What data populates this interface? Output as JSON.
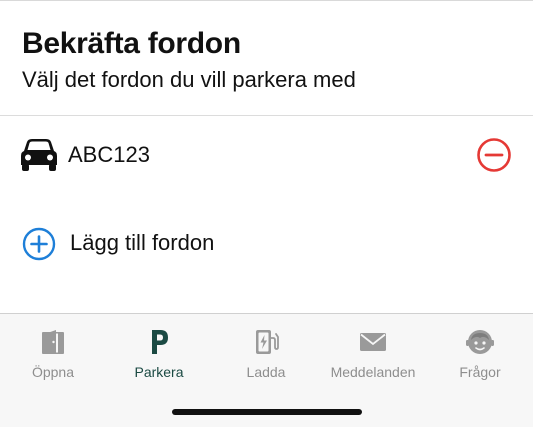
{
  "header": {
    "title": "Bekräfta fordon",
    "subtitle": "Välj det fordon du vill parkera med"
  },
  "vehicles": [
    {
      "plate": "ABC123",
      "icon": "car-icon",
      "action_icon": "minus-circle-icon"
    }
  ],
  "add_vehicle": {
    "label": "Lägg till fordon",
    "icon": "plus-circle-icon"
  },
  "tabs": [
    {
      "label": "Öppna",
      "icon": "door-icon",
      "active": false
    },
    {
      "label": "Parkera",
      "icon": "parking-icon",
      "active": true
    },
    {
      "label": "Ladda",
      "icon": "charging-station-icon",
      "active": false
    },
    {
      "label": "Meddelanden",
      "icon": "envelope-icon",
      "active": false
    },
    {
      "label": "Frågor",
      "icon": "support-agent-icon",
      "active": false
    }
  ],
  "colors": {
    "remove": "#e53935",
    "add": "#1e7fd8",
    "active_tab": "#1b4a43",
    "inactive_tab": "#8e8e8e"
  }
}
